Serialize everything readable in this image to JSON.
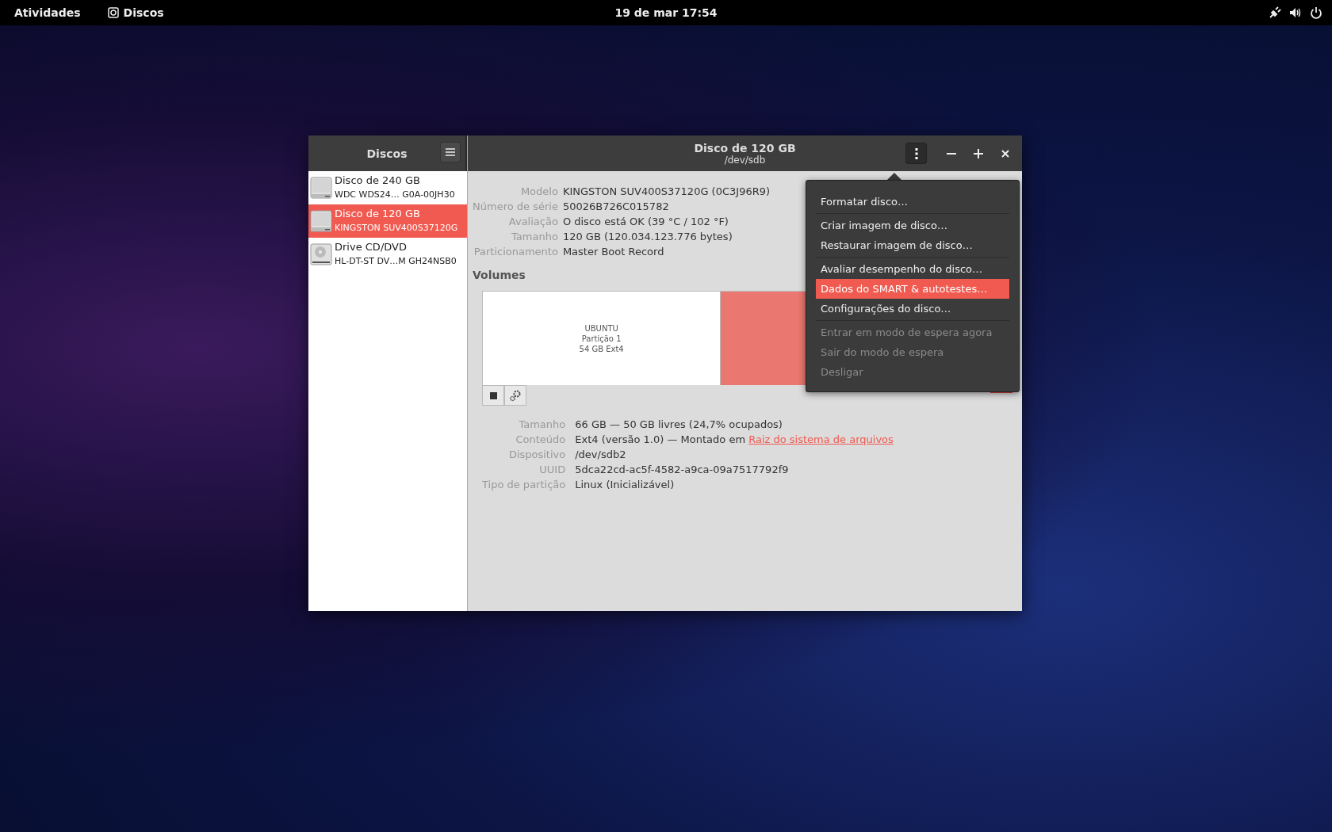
{
  "top_bar": {
    "activities": "Atividades",
    "app_name": "Discos",
    "clock": "19 de mar  17:54"
  },
  "window": {
    "sidebar": {
      "title": "Discos",
      "items": [
        {
          "name": "Disco de 240 GB",
          "detail": "WDC WDS24… G0A-00JH30",
          "kind": "hdd",
          "selected": false
        },
        {
          "name": "Disco de 120 GB",
          "detail": "KINGSTON SUV400S37120G",
          "kind": "hdd",
          "selected": true
        },
        {
          "name": "Drive CD/DVD",
          "detail": "HL-DT-ST DV…M GH24NSB0",
          "kind": "optical",
          "selected": false
        }
      ]
    },
    "header": {
      "title": "Disco de 120 GB",
      "subtitle": "/dev/sdb"
    },
    "disk_info": [
      {
        "label": "Modelo",
        "value": "KINGSTON SUV400S37120G (0C3J96R9)"
      },
      {
        "label": "Número de série",
        "value": "50026B726C015782"
      },
      {
        "label": "Avaliação",
        "value": "O disco está OK (39 °C / 102 °F)"
      },
      {
        "label": "Tamanho",
        "value": "120 GB (120.034.123.776 bytes)"
      },
      {
        "label": "Particionamento",
        "value": "Master Boot Record"
      }
    ],
    "volumes_title": "Volumes",
    "partitions": [
      {
        "lines": [
          "UBUNTU",
          "Partição 1",
          "54 GB Ext4"
        ],
        "selected": false
      },
      {
        "selected": true
      }
    ],
    "volume_info": [
      {
        "label": "Tamanho",
        "value": "66 GB — 50 GB livres (24,7% ocupados)"
      },
      {
        "label": "Conteúdo",
        "value": "Ext4 (versão 1.0) — Montado em ",
        "link": "Raiz do sistema de arquivos"
      },
      {
        "label": "Dispositivo",
        "value": "/dev/sdb2"
      },
      {
        "label": "UUID",
        "value": "5dca22cd-ac5f-4582-a9ca-09a7517792f9"
      },
      {
        "label": "Tipo de partição",
        "value": "Linux (Inicializável)"
      }
    ],
    "menu": [
      [
        {
          "label": "Formatar disco…",
          "disabled": false,
          "selected": false
        }
      ],
      [
        {
          "label": "Criar imagem de disco…",
          "disabled": false,
          "selected": false
        },
        {
          "label": "Restaurar imagem de disco…",
          "disabled": false,
          "selected": false
        }
      ],
      [
        {
          "label": "Avaliar desempenho do disco…",
          "disabled": false,
          "selected": false
        },
        {
          "label": "Dados do SMART & autotestes…",
          "disabled": false,
          "selected": true
        },
        {
          "label": "Configurações do disco…",
          "disabled": false,
          "selected": false
        }
      ],
      [
        {
          "label": "Entrar em modo de espera agora",
          "disabled": true,
          "selected": false
        },
        {
          "label": "Sair do modo de espera",
          "disabled": true,
          "selected": false
        },
        {
          "label": "Desligar",
          "disabled": true,
          "selected": false
        }
      ]
    ]
  }
}
